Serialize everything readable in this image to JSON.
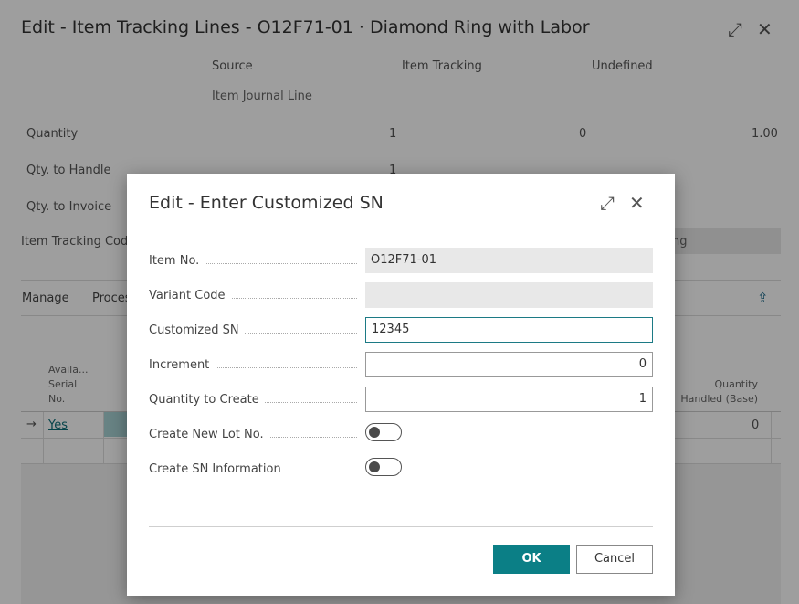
{
  "background": {
    "title": "Edit - Item Tracking Lines - O12F71-01 · Diamond Ring with Labor",
    "column_headers": [
      "Source",
      "Item Tracking",
      "Undefined"
    ],
    "source_type": "Item Journal Line",
    "rows": [
      {
        "label": "Quantity",
        "source": "1",
        "item_tracking": "0",
        "undefined": "1.00"
      },
      {
        "label": "Qty. to Handle",
        "source": "1"
      },
      {
        "label": "Qty. to Invoice"
      }
    ],
    "item_tracking_code_label": "Item Tracking Code",
    "item_tracking_code_value": "ng",
    "actions": [
      "Manage",
      "Process"
    ],
    "grid_header_available": "Availa... Serial No.",
    "grid_header_qty_handled": "Quantity Handled (Base)",
    "grid_row": {
      "available": "Yes",
      "qty_handled": "0"
    }
  },
  "dialog": {
    "title": "Edit - Enter Customized SN",
    "fields": {
      "item_no": {
        "label": "Item No.",
        "value": "O12F71-01"
      },
      "variant_code": {
        "label": "Variant Code",
        "value": ""
      },
      "customized_sn": {
        "label": "Customized SN",
        "value": "12345"
      },
      "increment": {
        "label": "Increment",
        "value": "0"
      },
      "quantity_to_create": {
        "label": "Quantity to Create",
        "value": "1"
      },
      "create_new_lot_no": {
        "label": "Create New Lot No.",
        "on": false
      },
      "create_sn_information": {
        "label": "Create SN Information",
        "on": false
      }
    },
    "ok_label": "OK",
    "cancel_label": "Cancel"
  },
  "icons": {
    "expand": "expand-icon",
    "close": "close-icon",
    "share": "share-icon",
    "arrow": "row-arrow-icon"
  },
  "colors": {
    "accent": "#0b7f86",
    "overlay": "rgba(0,0,0,0.38)"
  }
}
